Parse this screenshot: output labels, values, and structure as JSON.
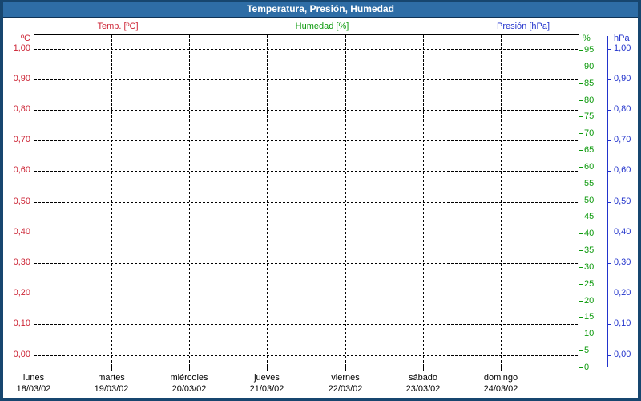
{
  "window": {
    "title": "Temperatura, Presión, Humedad"
  },
  "colors": {
    "titlebar": "#2E6DA6",
    "frame": "#17466F",
    "temp": "#CC2233",
    "humidity": "#0C9A0C",
    "pressure": "#2233CC",
    "grid": "#000000",
    "plot_background": "#FFFFFF"
  },
  "chart_data": {
    "type": "line",
    "title": "Temperatura, Presión, Humedad",
    "grid": true,
    "grid_style": "dashed",
    "legend_position": "top",
    "plot_is_empty": true,
    "series": [
      {
        "name": "Temp. [ºC]",
        "unit": "ºC",
        "color": "#CC2233",
        "axis_side": "left",
        "axis_range": [
          0.0,
          1.0
        ],
        "axis_step": 0.1,
        "tick_labels": [
          "1,00",
          "0,90",
          "0,80",
          "0,70",
          "0,60",
          "0,50",
          "0,40",
          "0,30",
          "0,20",
          "0,10",
          "0,00"
        ],
        "values": []
      },
      {
        "name": "Humedad [%]",
        "unit": "%",
        "color": "#0C9A0C",
        "axis_side": "right-inner",
        "axis_range": [
          0,
          100
        ],
        "axis_step": 5,
        "tick_labels": [
          "95",
          "90",
          "85",
          "80",
          "75",
          "70",
          "65",
          "60",
          "55",
          "50",
          "45",
          "40",
          "35",
          "30",
          "25",
          "20",
          "15",
          "10",
          "5",
          "0"
        ],
        "values": []
      },
      {
        "name": "Presión [hPa]",
        "unit": "hPa",
        "color": "#2233CC",
        "axis_side": "right-outer",
        "axis_range": [
          0.0,
          1.0
        ],
        "axis_step": 0.1,
        "tick_labels": [
          "1,00",
          "0,90",
          "0,80",
          "0,70",
          "0,60",
          "0,50",
          "0,40",
          "0,30",
          "0,20",
          "0,10",
          "0,00"
        ],
        "values": []
      }
    ],
    "x": {
      "label_rows": [
        "day_name",
        "date"
      ],
      "days": [
        {
          "name": "lunes",
          "date": "18/03/02"
        },
        {
          "name": "martes",
          "date": "19/03/02"
        },
        {
          "name": "miércoles",
          "date": "20/03/02"
        },
        {
          "name": "jueves",
          "date": "21/03/02"
        },
        {
          "name": "viernes",
          "date": "22/03/02"
        },
        {
          "name": "sábado",
          "date": "23/03/02"
        },
        {
          "name": "domingo",
          "date": "24/03/02"
        }
      ]
    }
  }
}
